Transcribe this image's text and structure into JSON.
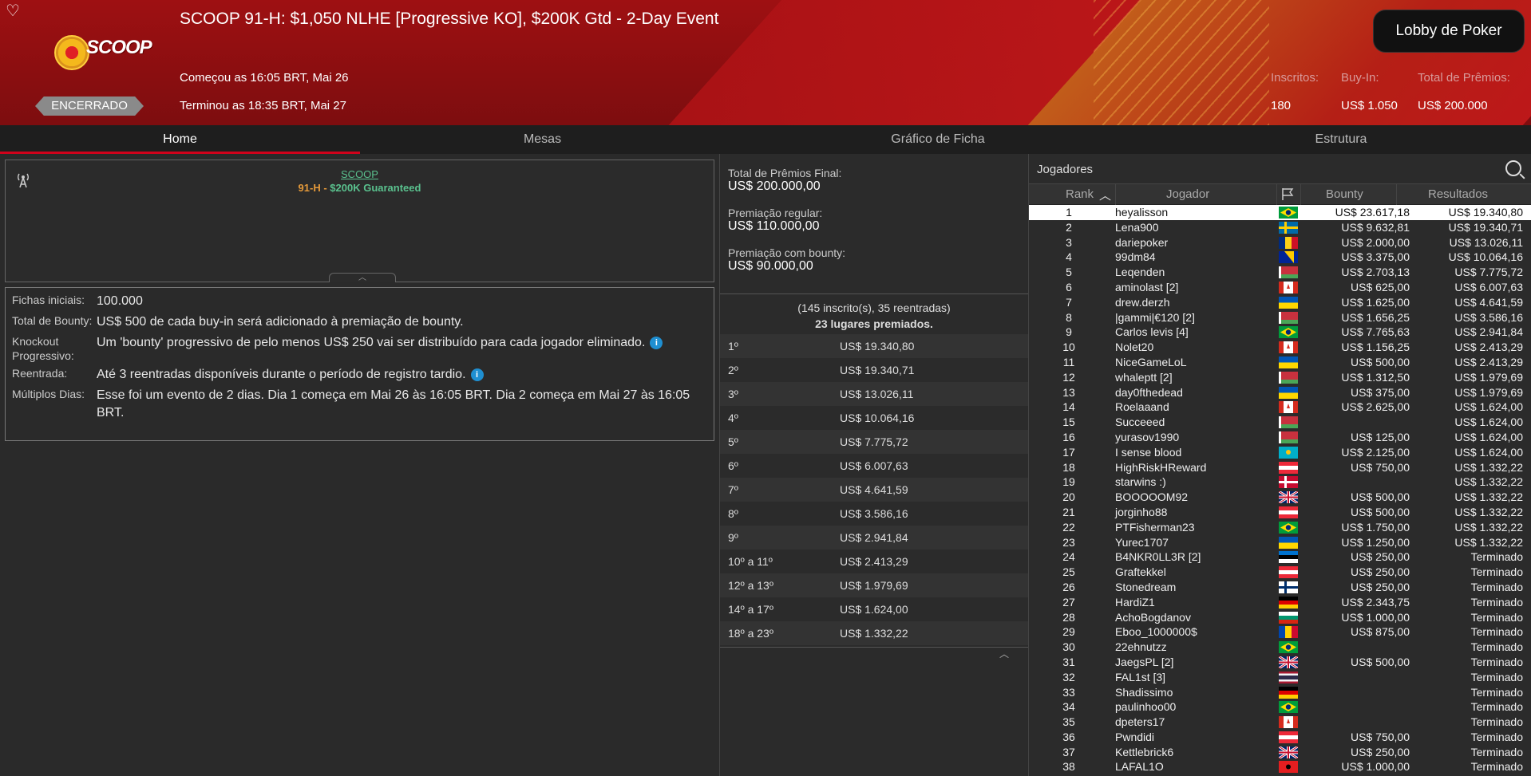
{
  "header": {
    "title": "SCOOP 91-H: $1,050 NLHE [Progressive KO], $200K Gtd - 2-Day Event",
    "logo_text": "SCOOP",
    "status": "ENCERRADO",
    "began": "Começou as 16:05 BRT, Mai 26",
    "ended": "Terminou as 18:35 BRT, Mai 27",
    "lobby_button": "Lobby de Poker",
    "registered_label": "Inscritos:",
    "registered_value": "180",
    "buyin_label": "Buy-In:",
    "buyin_value": "US$ 1.050",
    "prize_label": "Total de Prêmios:",
    "prize_value": "US$ 200.000"
  },
  "tabs": [
    "Home",
    "Mesas",
    "Gráfico de Ficha",
    "Estrutura"
  ],
  "banner": {
    "link": "SCOOP",
    "event_code": "91-H",
    "dash": " - ",
    "guarantee": "$200K Guaranteed"
  },
  "info": [
    {
      "label": "Fichas iniciais:",
      "value": "100.000",
      "icon": false
    },
    {
      "label": "Total de Bounty:",
      "value": "US$ 500 de cada buy-in será adicionado à premiação de bounty.",
      "icon": false
    },
    {
      "label": "Knockout Progressivo:",
      "value": "Um 'bounty' progressivo de pelo menos US$ 250 vai ser distribuído para cada jogador eliminado.",
      "icon": true
    },
    {
      "label": "Reentrada:",
      "value": "Até 3 reentradas disponíveis durante o período de registro tardio.",
      "icon": true
    },
    {
      "label": "Múltiplos Dias:",
      "value": "Esse foi um evento de 2 dias. Dia 1 começa em Mai 26 às 16:05 BRT. Dia 2 começa em Mai 27 às 16:05 BRT.",
      "icon": false
    }
  ],
  "prizes": {
    "final_label": "Total de Prêmios Final:",
    "final_value": "US$ 200.000,00",
    "regular_label": "Premiação regular:",
    "regular_value": "US$ 110.000,00",
    "bounty_label": "Premiação com bounty:",
    "bounty_value": "US$ 90.000,00",
    "summary_line1": "(145 inscrito(s), 35 reentradas)",
    "summary_line2": "23 lugares premiados.",
    "payouts": [
      {
        "place": "1º",
        "amount": "US$ 19.340,80"
      },
      {
        "place": "2º",
        "amount": "US$ 19.340,71"
      },
      {
        "place": "3º",
        "amount": "US$ 13.026,11"
      },
      {
        "place": "4º",
        "amount": "US$ 10.064,16"
      },
      {
        "place": "5º",
        "amount": "US$ 7.775,72"
      },
      {
        "place": "6º",
        "amount": "US$ 6.007,63"
      },
      {
        "place": "7º",
        "amount": "US$ 4.641,59"
      },
      {
        "place": "8º",
        "amount": "US$ 3.586,16"
      },
      {
        "place": "9º",
        "amount": "US$ 2.941,84"
      },
      {
        "place": "10º a 11º",
        "amount": "US$ 2.413,29"
      },
      {
        "place": "12º a 13º",
        "amount": "US$ 1.979,69"
      },
      {
        "place": "14º a 17º",
        "amount": "US$ 1.624,00"
      },
      {
        "place": "18º a 23º",
        "amount": "US$ 1.332,22"
      }
    ]
  },
  "players": {
    "title": "Jogadores",
    "columns": {
      "rank": "Rank",
      "player": "Jogador",
      "bounty": "Bounty",
      "results": "Resultados"
    },
    "rows": [
      {
        "rank": "1",
        "name": "heyalisson",
        "flag": "br",
        "bounty": "US$ 23.617,18",
        "result": "US$ 19.340,80"
      },
      {
        "rank": "2",
        "name": "Lena900",
        "flag": "se",
        "bounty": "US$ 9.632,81",
        "result": "US$ 19.340,71"
      },
      {
        "rank": "3",
        "name": "dariepoker",
        "flag": "ro",
        "bounty": "US$ 2.000,00",
        "result": "US$ 13.026,11"
      },
      {
        "rank": "4",
        "name": "99dm84",
        "flag": "ba",
        "bounty": "US$ 3.375,00",
        "result": "US$ 10.064,16"
      },
      {
        "rank": "5",
        "name": "Leqenden",
        "flag": "by",
        "bounty": "US$ 2.703,13",
        "result": "US$ 7.775,72"
      },
      {
        "rank": "6",
        "name": "aminolast [2]",
        "flag": "ca",
        "bounty": "US$ 625,00",
        "result": "US$ 6.007,63"
      },
      {
        "rank": "7",
        "name": "drew.derzh",
        "flag": "ua",
        "bounty": "US$ 1.625,00",
        "result": "US$ 4.641,59"
      },
      {
        "rank": "8",
        "name": "|gammi|€120 [2]",
        "flag": "by",
        "bounty": "US$ 1.656,25",
        "result": "US$ 3.586,16"
      },
      {
        "rank": "9",
        "name": "Carlos levis [4]",
        "flag": "br",
        "bounty": "US$ 7.765,63",
        "result": "US$ 2.941,84"
      },
      {
        "rank": "10",
        "name": "Nolet20",
        "flag": "ca",
        "bounty": "US$ 1.156,25",
        "result": "US$ 2.413,29"
      },
      {
        "rank": "11",
        "name": "NiceGameLoL",
        "flag": "ua",
        "bounty": "US$ 500,00",
        "result": "US$ 2.413,29"
      },
      {
        "rank": "12",
        "name": "whaleptt [2]",
        "flag": "by",
        "bounty": "US$ 1.312,50",
        "result": "US$ 1.979,69"
      },
      {
        "rank": "13",
        "name": "day0fthedead",
        "flag": "ua",
        "bounty": "US$ 375,00",
        "result": "US$ 1.979,69"
      },
      {
        "rank": "14",
        "name": "Roelaaand",
        "flag": "ca",
        "bounty": "US$ 2.625,00",
        "result": "US$ 1.624,00"
      },
      {
        "rank": "15",
        "name": "Succeeed",
        "flag": "by",
        "bounty": "",
        "result": "US$ 1.624,00"
      },
      {
        "rank": "16",
        "name": "yurasov1990",
        "flag": "by",
        "bounty": "US$ 125,00",
        "result": "US$ 1.624,00"
      },
      {
        "rank": "17",
        "name": "I sense blood",
        "flag": "kz",
        "bounty": "US$ 2.125,00",
        "result": "US$ 1.624,00"
      },
      {
        "rank": "18",
        "name": "HighRiskHReward",
        "flag": "at",
        "bounty": "US$ 750,00",
        "result": "US$ 1.332,22"
      },
      {
        "rank": "19",
        "name": "starwins :)",
        "flag": "dk",
        "bounty": "",
        "result": "US$ 1.332,22"
      },
      {
        "rank": "20",
        "name": "BOOOOOM92",
        "flag": "gb",
        "bounty": "US$ 500,00",
        "result": "US$ 1.332,22"
      },
      {
        "rank": "21",
        "name": "jorginho88",
        "flag": "at",
        "bounty": "US$ 500,00",
        "result": "US$ 1.332,22"
      },
      {
        "rank": "22",
        "name": "PTFisherman23",
        "flag": "br",
        "bounty": "US$ 1.750,00",
        "result": "US$ 1.332,22"
      },
      {
        "rank": "23",
        "name": "Yurec1707",
        "flag": "ua",
        "bounty": "US$ 1.250,00",
        "result": "US$ 1.332,22"
      },
      {
        "rank": "24",
        "name": "B4NKR0LL3R [2]",
        "flag": "ee",
        "bounty": "US$ 250,00",
        "result": "Terminado"
      },
      {
        "rank": "25",
        "name": "Graftekkel",
        "flag": "at",
        "bounty": "US$ 250,00",
        "result": "Terminado"
      },
      {
        "rank": "26",
        "name": "Stonedream",
        "flag": "fi",
        "bounty": "US$ 250,00",
        "result": "Terminado"
      },
      {
        "rank": "27",
        "name": "HardiZ1",
        "flag": "de",
        "bounty": "US$ 2.343,75",
        "result": "Terminado"
      },
      {
        "rank": "28",
        "name": "AchoBogdanov",
        "flag": "bg",
        "bounty": "US$ 1.000,00",
        "result": "Terminado"
      },
      {
        "rank": "29",
        "name": "Eboo_1000000$",
        "flag": "md",
        "bounty": "US$ 875,00",
        "result": "Terminado"
      },
      {
        "rank": "30",
        "name": "22ehnutzz",
        "flag": "br",
        "bounty": "",
        "result": "Terminado"
      },
      {
        "rank": "31",
        "name": "JaegsPL [2]",
        "flag": "gb",
        "bounty": "US$ 500,00",
        "result": "Terminado"
      },
      {
        "rank": "32",
        "name": "FAL1st [3]",
        "flag": "th",
        "bounty": "",
        "result": "Terminado"
      },
      {
        "rank": "33",
        "name": "Shadissimo",
        "flag": "de",
        "bounty": "",
        "result": "Terminado"
      },
      {
        "rank": "34",
        "name": "paulinhoo00",
        "flag": "br",
        "bounty": "",
        "result": "Terminado"
      },
      {
        "rank": "35",
        "name": "dpeters17",
        "flag": "ca",
        "bounty": "",
        "result": "Terminado"
      },
      {
        "rank": "36",
        "name": "Pwndidi",
        "flag": "at",
        "bounty": "US$ 750,00",
        "result": "Terminado"
      },
      {
        "rank": "37",
        "name": "Kettlebrick6",
        "flag": "gb",
        "bounty": "US$ 250,00",
        "result": "Terminado"
      },
      {
        "rank": "38",
        "name": "LAFAL1O",
        "flag": "al",
        "bounty": "US$ 1.000,00",
        "result": "Terminado"
      }
    ]
  },
  "colors": {
    "accent": "#d0021b",
    "header": "#9e1012",
    "link": "#5ac18e",
    "event_code": "#e59a3a"
  }
}
